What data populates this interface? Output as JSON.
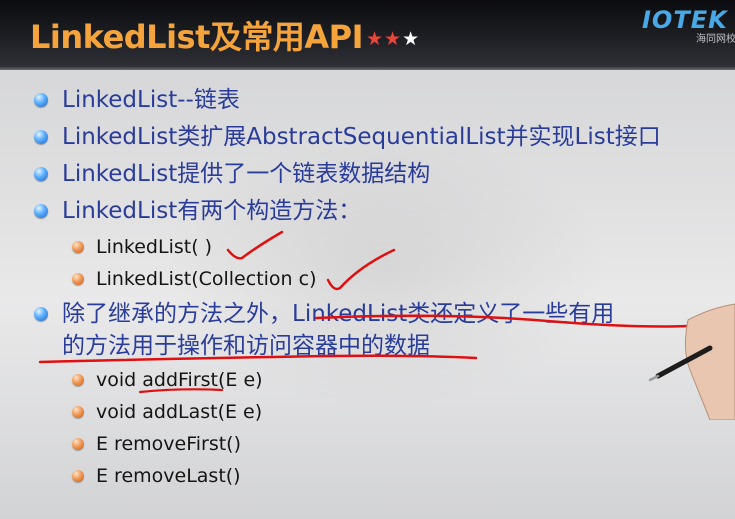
{
  "header": {
    "title": "LinkedList及常用API",
    "stars_filled": "★★",
    "stars_empty": "★",
    "logo": "IOTEK",
    "logo_sub": "海同网校"
  },
  "bullets": [
    {
      "text": "LinkedList--链表"
    },
    {
      "text": "LinkedList类扩展AbstractSequentialList并实现List接口"
    },
    {
      "text": "LinkedList提供了一个链表数据结构"
    },
    {
      "text": "LinkedList有两个构造方法："
    }
  ],
  "constructors": [
    {
      "text": "LinkedList( )"
    },
    {
      "text": "LinkedList(Collection c)"
    }
  ],
  "methods_intro": {
    "line1": "除了继承的方法之外，LinkedList类还定义了一些有用",
    "line2": "的方法用于操作和访问容器中的数据"
  },
  "methods": [
    {
      "text": "void addFirst(E  e)"
    },
    {
      "text": "void addLast(E  e)"
    },
    {
      "text": "E  removeFirst()"
    },
    {
      "text": "E  removeLast()"
    }
  ],
  "colors": {
    "title": "#f5a43b",
    "bullet_text": "#2a3c9a",
    "annotation_red": "#e01010",
    "star_red": "#e7443a"
  }
}
